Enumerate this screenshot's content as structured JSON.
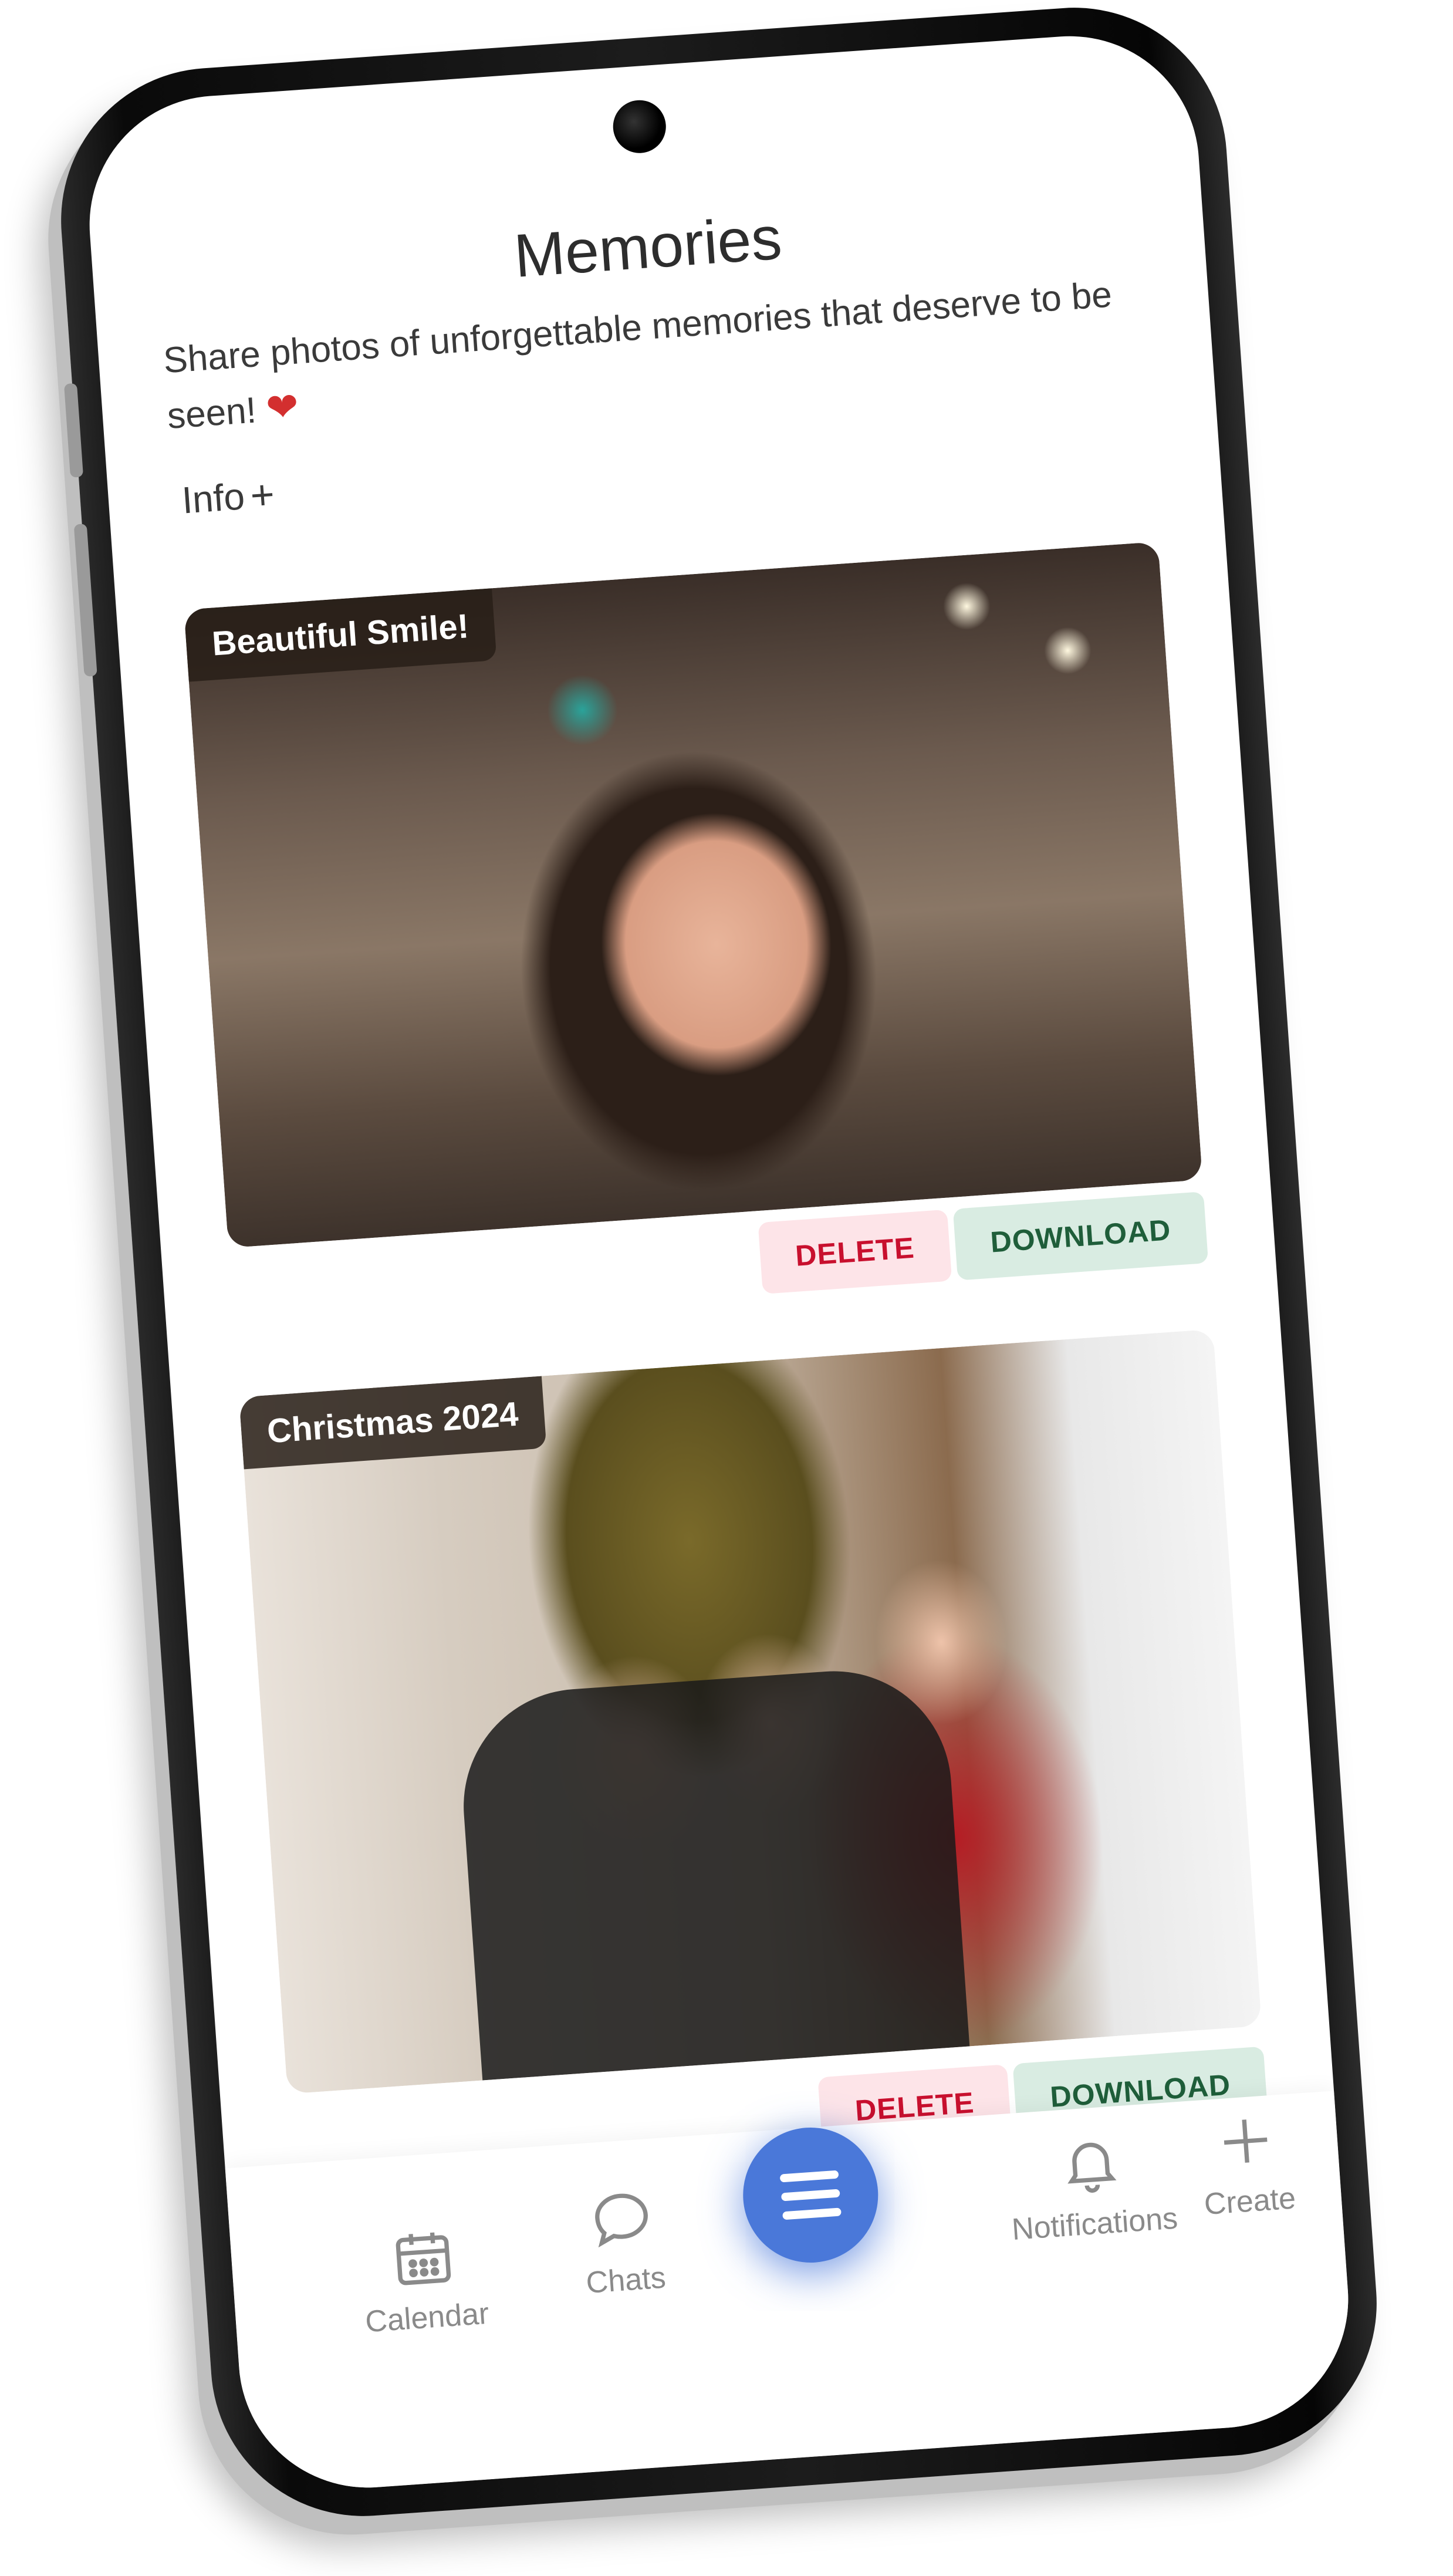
{
  "header": {
    "title": "Memories",
    "subtitle": "Share photos of unforgettable memories that deserve to be seen!",
    "heart_icon": "heart-icon",
    "info_label": "Info",
    "info_icon": "plus-icon"
  },
  "memories": [
    {
      "caption": "Beautiful Smile!",
      "delete_label": "DELETE",
      "download_label": "DOWNLOAD"
    },
    {
      "caption": "Christmas 2024",
      "delete_label": "DELETE",
      "download_label": "DOWNLOAD"
    }
  ],
  "nav": {
    "items": [
      {
        "label": "Calendar",
        "icon": "calendar-icon"
      },
      {
        "label": "Chats",
        "icon": "chat-bubble-icon"
      },
      {
        "label": "Notifications",
        "icon": "bell-icon"
      },
      {
        "label": "Create",
        "icon": "plus-icon"
      }
    ],
    "fab_icon": "menu-icon"
  },
  "colors": {
    "accent": "#4a78d9",
    "delete_bg": "#fde4e8",
    "delete_text": "#c8102e",
    "download_bg": "#d9ece2",
    "download_text": "#1f5e3a",
    "heart": "#d32f2f"
  }
}
